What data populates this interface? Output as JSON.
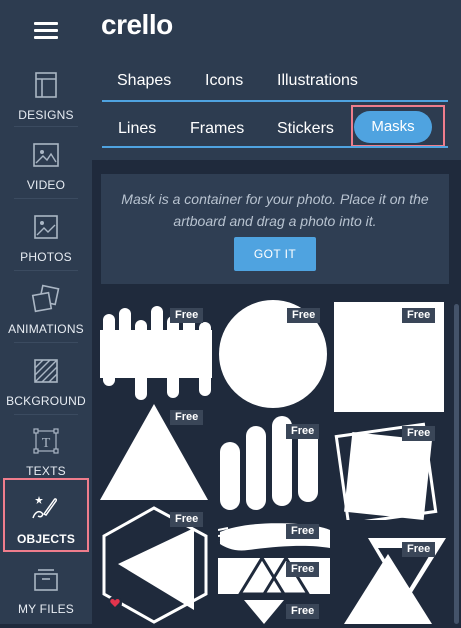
{
  "app": {
    "logo": "crello"
  },
  "sidebar": {
    "items": [
      {
        "label": "DESIGNS",
        "icon": "designs-icon"
      },
      {
        "label": "VIDEO",
        "icon": "video-icon"
      },
      {
        "label": "PHOTOS",
        "icon": "photos-icon"
      },
      {
        "label": "ANIMATIONS",
        "icon": "animations-icon"
      },
      {
        "label": "BCKGROUND",
        "icon": "background-icon"
      },
      {
        "label": "TEXTS",
        "icon": "texts-icon"
      },
      {
        "label": "OBJECTS",
        "icon": "objects-icon",
        "active": true
      },
      {
        "label": "MY FILES",
        "icon": "my-files-icon"
      }
    ]
  },
  "tabs": {
    "row1": [
      "Shapes",
      "Icons",
      "Illustrations"
    ],
    "row2": [
      "Lines",
      "Frames",
      "Stickers",
      "Masks"
    ],
    "selected": "Masks"
  },
  "info": {
    "text": "Mask is a container for your photo. Place it on the artboard and drag a photo into it.",
    "button": "GOT IT"
  },
  "grid": {
    "badge": "Free",
    "items": [
      {
        "shape": "drips",
        "badge": "Free"
      },
      {
        "shape": "circle",
        "badge": "Free"
      },
      {
        "shape": "square",
        "badge": "Free"
      },
      {
        "shape": "triangle",
        "badge": "Free"
      },
      {
        "shape": "capsules",
        "badge": "Free"
      },
      {
        "shape": "tilted-squares",
        "badge": "Free"
      },
      {
        "shape": "hexagon-triangle",
        "badge": "Free"
      },
      {
        "shape": "brush-stroke",
        "badge": "Free"
      },
      {
        "shape": "triangle-band",
        "badge": "Free"
      },
      {
        "shape": "down-triangle",
        "badge": "Free"
      },
      {
        "shape": "partial",
        "badge": "Free"
      }
    ]
  },
  "colors": {
    "accent": "#4fa3e0",
    "sidebar": "#2d3c50",
    "panel": "#1f2a3c",
    "highlight": "#ef7d8c"
  }
}
